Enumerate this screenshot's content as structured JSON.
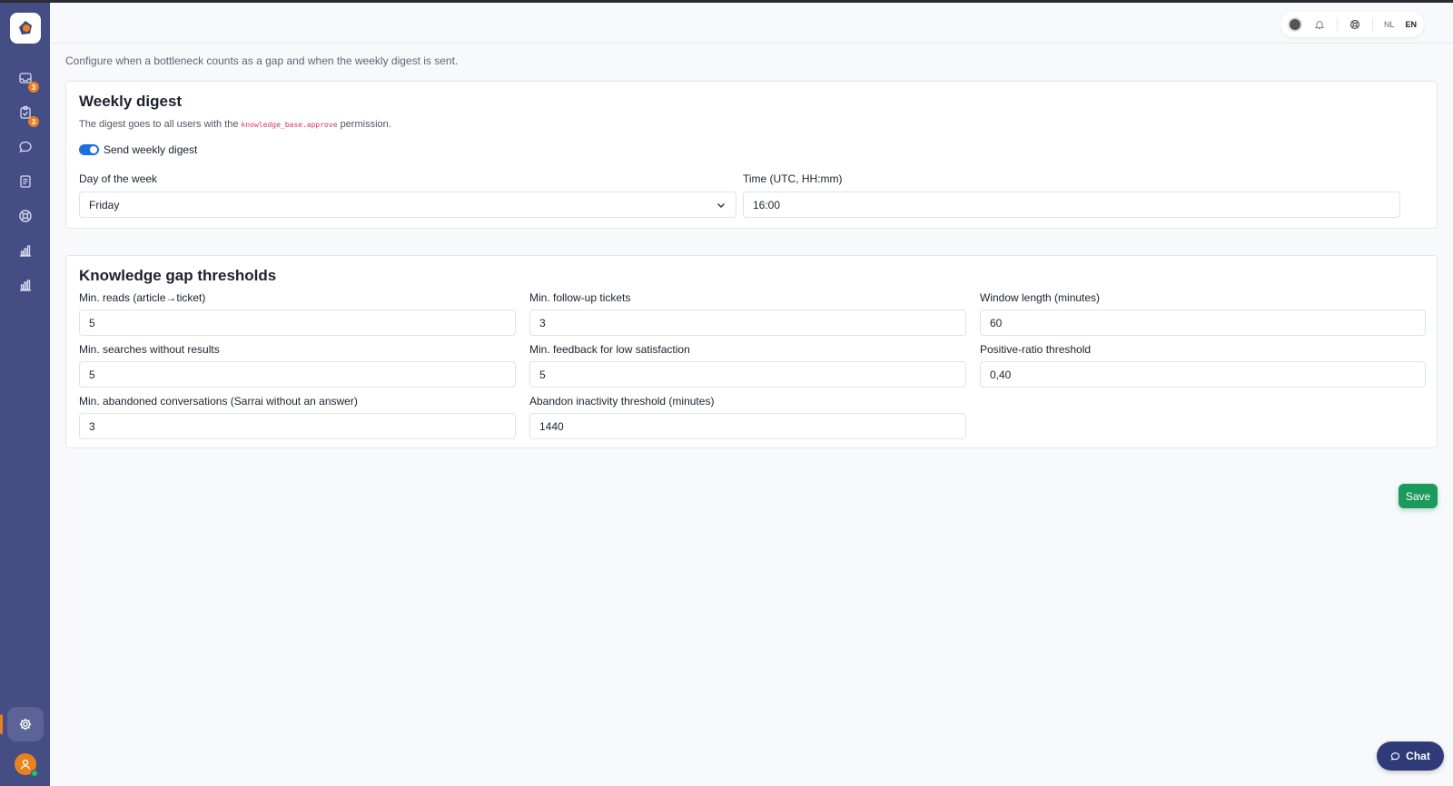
{
  "header": {
    "languages": [
      "NL",
      "EN"
    ],
    "active_language": "EN"
  },
  "sidebar": {
    "items": [
      {
        "icon": "inbox-icon",
        "badge": "3"
      },
      {
        "icon": "clipboard-icon",
        "badge": "3"
      },
      {
        "icon": "chat-bubble-icon"
      },
      {
        "icon": "document-icon"
      },
      {
        "icon": "lifebuoy-icon"
      },
      {
        "icon": "chart-icon"
      },
      {
        "icon": "bar-chart-icon"
      }
    ],
    "active_item": "settings-icon"
  },
  "page": {
    "subtitle": "Configure when a bottleneck counts as a gap and when the weekly digest is sent."
  },
  "digest": {
    "title": "Weekly digest",
    "desc_before": "The digest goes to all users with the ",
    "permission": "knowledge_base.approve",
    "desc_after": " permission.",
    "toggle_label": "Send weekly digest",
    "toggle_on": true,
    "day_label": "Day of the week",
    "day_value": "Friday",
    "time_label": "Time (UTC, HH:mm)",
    "time_value": "16:00"
  },
  "thresholds": {
    "title": "Knowledge gap thresholds",
    "fields": [
      {
        "label": "Min. reads (article→ticket)",
        "value": "5"
      },
      {
        "label": "Min. follow-up tickets",
        "value": "3"
      },
      {
        "label": "Window length (minutes)",
        "value": "60"
      },
      {
        "label": "Min. searches without results",
        "value": "5"
      },
      {
        "label": "Min. feedback for low satisfaction",
        "value": "5"
      },
      {
        "label": "Positive-ratio threshold",
        "value": "0,40"
      },
      {
        "label": "Min. abandoned conversations (Sarrai without an answer)",
        "value": "3"
      },
      {
        "label": "Abandon inactivity threshold (minutes)",
        "value": "1440"
      }
    ]
  },
  "actions": {
    "save_label": "Save",
    "chat_label": "Chat"
  },
  "colors": {
    "sidebar": "#454d85",
    "accent_orange": "#e8821e",
    "save_green": "#1a9a5c",
    "toggle_blue": "#1d6fe0",
    "chat": "#2f3a78"
  }
}
